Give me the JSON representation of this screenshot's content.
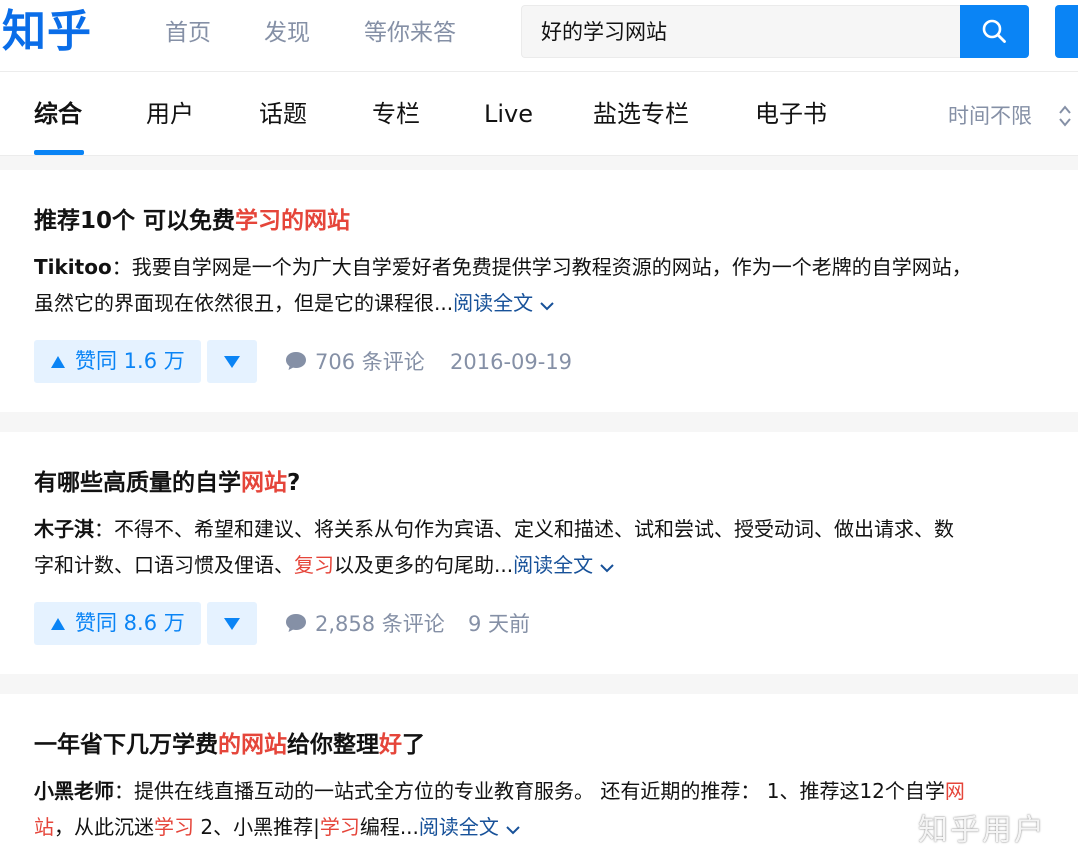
{
  "colors": {
    "brand": "#0a84f5",
    "highlight": "#e5453a",
    "link": "#175199",
    "muted": "#8590a6"
  },
  "header": {
    "logo": "知乎",
    "nav": [
      "首页",
      "发现",
      "等你来答"
    ],
    "search": {
      "value": "好的学习网站",
      "icon": "search-icon"
    }
  },
  "tabs": {
    "items": [
      "综合",
      "用户",
      "话题",
      "专栏",
      "Live",
      "盐选专栏",
      "电子书"
    ],
    "active": "综合",
    "time_filter": "时间不限"
  },
  "results": [
    {
      "title": [
        {
          "text": "推荐10个 可以免费",
          "hl": false
        },
        {
          "text": "学习的网站",
          "hl": true
        }
      ],
      "author": "Tikitoo",
      "excerpt_line1": [
        {
          "text": "：我要自学网是一个为广大自学爱好者免费提供学习教程资源的网站，作为一个老牌的自学网站，",
          "hl": false
        }
      ],
      "excerpt_line2": [
        {
          "text": "虽然它的界面现在依然很丑，但是它的课程很...",
          "hl": false
        }
      ],
      "read_more": "阅读全文",
      "vote": "赞同 1.6 万",
      "comments": "706 条评论",
      "time": "2016-09-19"
    },
    {
      "title": [
        {
          "text": "有哪些高质量的自学",
          "hl": false
        },
        {
          "text": "网站",
          "hl": true
        },
        {
          "text": "?",
          "hl": false
        }
      ],
      "author": "木子淇",
      "excerpt_line1": [
        {
          "text": "：不得不、希望和建议、将关系从句作为宾语、定义和描述、试和尝试、授受动词、做出请求、数",
          "hl": false
        }
      ],
      "excerpt_line2": [
        {
          "text": "字和计数、口语习惯及俚语、",
          "hl": false
        },
        {
          "text": "复习",
          "hl": true
        },
        {
          "text": "以及更多的句尾助...",
          "hl": false
        }
      ],
      "read_more": "阅读全文",
      "vote": "赞同 8.6 万",
      "comments": "2,858 条评论",
      "time": "9 天前"
    },
    {
      "title": [
        {
          "text": "一年省下几万学费",
          "hl": false
        },
        {
          "text": "的网站",
          "hl": true
        },
        {
          "text": "给你整理",
          "hl": false
        },
        {
          "text": "好",
          "hl": true
        },
        {
          "text": "了",
          "hl": false
        }
      ],
      "author": "小黑老师",
      "excerpt_line1": [
        {
          "text": "：提供在线直播互动的一站式全方位的专业教育服务。 还有近期的推荐： 1、推荐这12个自学",
          "hl": false
        },
        {
          "text": "网",
          "hl": true
        }
      ],
      "excerpt_line2": [
        {
          "text": "站",
          "hl": true
        },
        {
          "text": "，从此沉迷",
          "hl": false
        },
        {
          "text": "学习",
          "hl": true
        },
        {
          "text": " 2、小黑推荐|",
          "hl": false
        },
        {
          "text": "学习",
          "hl": true
        },
        {
          "text": "编程...",
          "hl": false
        }
      ],
      "read_more": "阅读全文"
    }
  ],
  "watermark": "知乎用户"
}
